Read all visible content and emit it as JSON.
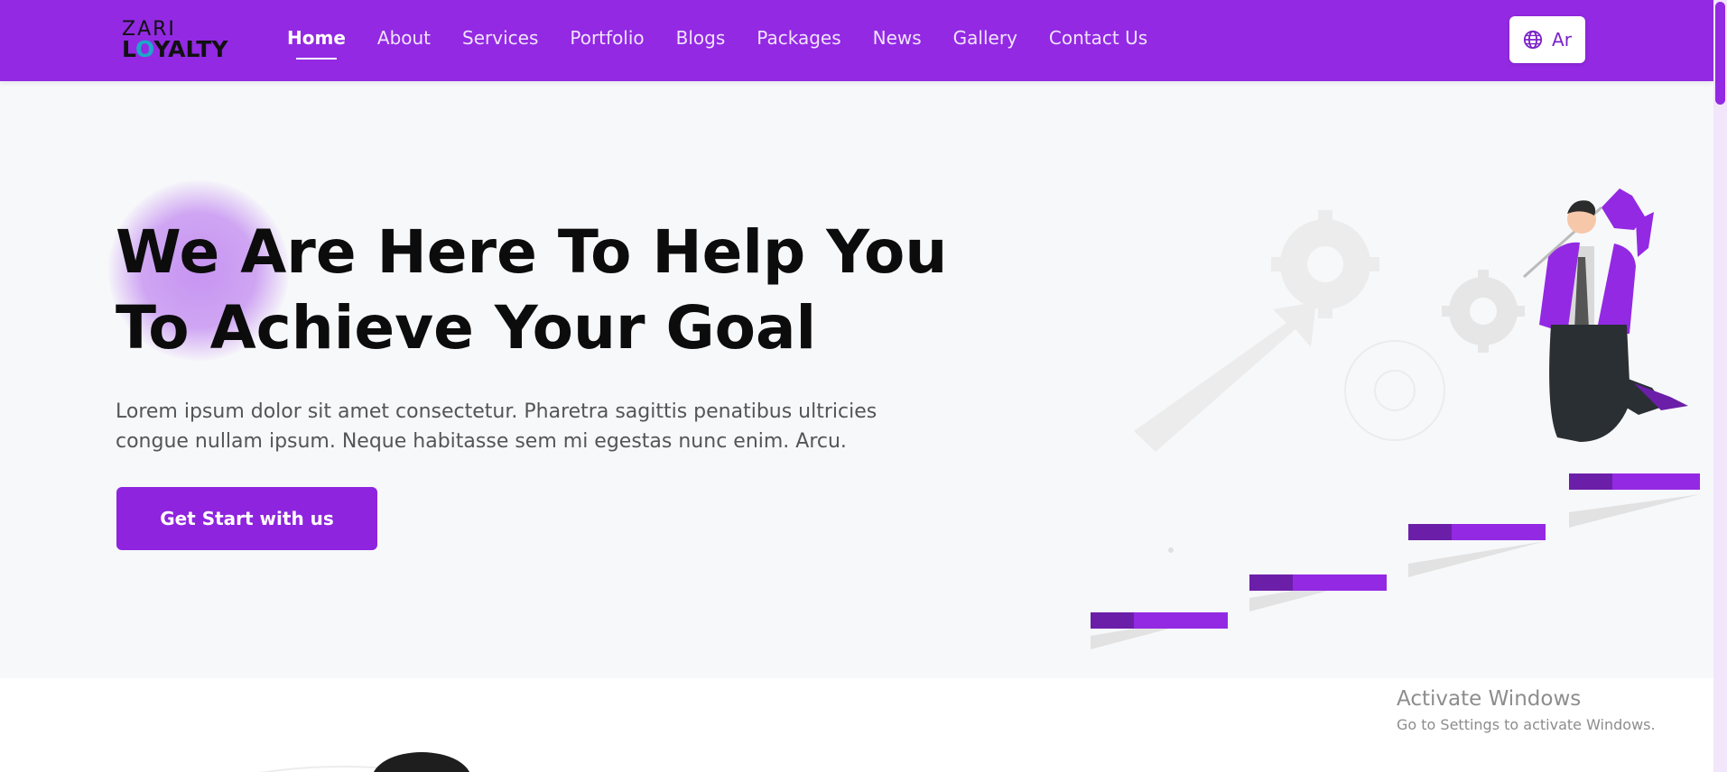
{
  "logo": {
    "line1": "ZARI",
    "line2_prefix": "L",
    "line2_o": "O",
    "line2_suffix": "YALTY"
  },
  "nav": {
    "items": [
      {
        "label": "Home",
        "active": true
      },
      {
        "label": "About"
      },
      {
        "label": "Services"
      },
      {
        "label": "Portfolio"
      },
      {
        "label": "Blogs"
      },
      {
        "label": "Packages"
      },
      {
        "label": "News"
      },
      {
        "label": "Gallery"
      },
      {
        "label": "Contact Us"
      }
    ]
  },
  "lang_button": {
    "label": "Ar",
    "icon": "globe-icon"
  },
  "hero": {
    "title": "We Are Here To Help You To Achieve Your Goal",
    "description": "Lorem ipsum dolor sit amet consectetur. Pharetra sagittis penatibus ultricies congue nullam ipsum. Neque habitasse sem mi egestas nunc enim. Arcu.",
    "cta_label": "Get Start with us"
  },
  "watermark": {
    "title": "Activate Windows",
    "subtitle": "Go to Settings to activate Windows."
  },
  "colors": {
    "brand": "#9329e3",
    "accent_dark": "#6b1fa8",
    "button": "#8e24de"
  }
}
